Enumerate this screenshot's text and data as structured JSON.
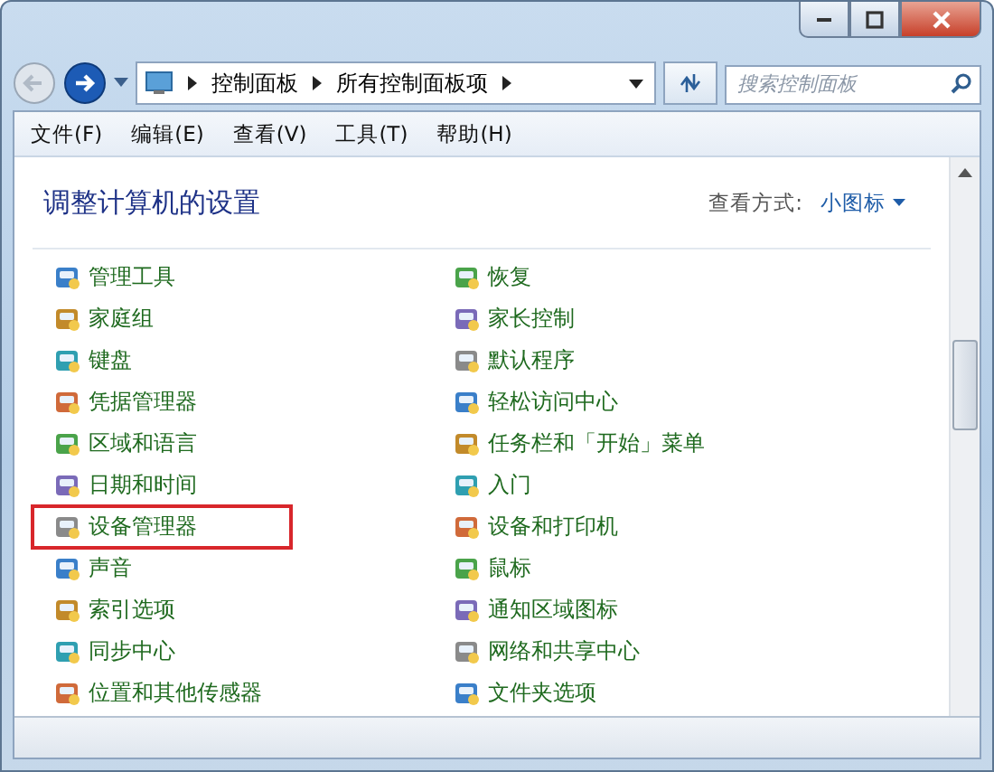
{
  "address_bar": {
    "crumbs": [
      "控制面板",
      "所有控制面板项"
    ]
  },
  "search": {
    "placeholder": "搜索控制面板"
  },
  "menu": [
    "文件(F)",
    "编辑(E)",
    "查看(V)",
    "工具(T)",
    "帮助(H)"
  ],
  "header": {
    "title": "调整计算机的设置",
    "view_label": "查看方式:",
    "view_value": "小图标"
  },
  "items": [
    {
      "label": "管理工具",
      "highlighted": false
    },
    {
      "label": "恢复",
      "highlighted": false
    },
    {
      "label": "家庭组",
      "highlighted": false
    },
    {
      "label": "家长控制",
      "highlighted": false
    },
    {
      "label": "键盘",
      "highlighted": false
    },
    {
      "label": "默认程序",
      "highlighted": false
    },
    {
      "label": "凭据管理器",
      "highlighted": false
    },
    {
      "label": "轻松访问中心",
      "highlighted": false
    },
    {
      "label": "区域和语言",
      "highlighted": false
    },
    {
      "label": "任务栏和「开始」菜单",
      "highlighted": false
    },
    {
      "label": "日期和时间",
      "highlighted": false
    },
    {
      "label": "入门",
      "highlighted": false
    },
    {
      "label": "设备管理器",
      "highlighted": true
    },
    {
      "label": "设备和打印机",
      "highlighted": false
    },
    {
      "label": "声音",
      "highlighted": false
    },
    {
      "label": "鼠标",
      "highlighted": false
    },
    {
      "label": "索引选项",
      "highlighted": false
    },
    {
      "label": "通知区域图标",
      "highlighted": false
    },
    {
      "label": "同步中心",
      "highlighted": false
    },
    {
      "label": "网络和共享中心",
      "highlighted": false
    },
    {
      "label": "位置和其他传感器",
      "highlighted": false
    },
    {
      "label": "文件夹选项",
      "highlighted": false
    }
  ]
}
